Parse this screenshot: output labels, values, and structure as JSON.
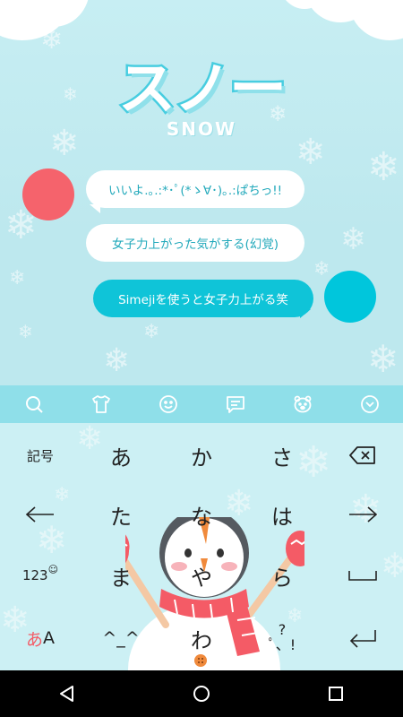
{
  "theme": {
    "title": "スノー",
    "subtitle": "SNOW",
    "colors": {
      "background": "#bfe9ef",
      "accent": "#0fc4d8",
      "logo_stroke": "#47cde0",
      "avatar_left": "#f5636c",
      "avatar_right": "#00c6dc",
      "toolbar": "#8fdfe9"
    }
  },
  "chat": {
    "messages": [
      {
        "side": "left",
        "text": "いいよ.｡.:*･ﾟ(*ゝ∀･)｡.:ぱちっ!!"
      },
      {
        "side": "left",
        "text": "女子力上がった気がする(幻覚)"
      },
      {
        "side": "right",
        "text": "Simejiを使うと女子力上がる笑"
      }
    ]
  },
  "toolbar": {
    "icons": [
      "search-icon",
      "tshirt-icon",
      "smiley-icon",
      "chat-icon",
      "bear-icon",
      "chevron-down-icon"
    ]
  },
  "keyboard": {
    "row1": {
      "left": "記号",
      "keys": [
        "あ",
        "か",
        "さ"
      ],
      "right_icon": "backspace-icon"
    },
    "row2": {
      "left_icon": "arrow-left-icon",
      "keys": [
        "た",
        "な",
        "は"
      ],
      "right_icon": "arrow-right-icon"
    },
    "row3": {
      "left": "123",
      "left_badge": "☺",
      "keys": [
        "ま",
        "や",
        "ら"
      ],
      "right_icon": "space-icon"
    },
    "row4": {
      "left_a": "あ",
      "left_b": "A",
      "keys": [
        "^_^",
        "わ",
        "ﾟ、!"
      ],
      "punct_top": "?",
      "right_icon": "enter-icon"
    }
  },
  "navbar": {
    "icons": [
      "back-icon",
      "home-icon",
      "recents-icon"
    ]
  }
}
